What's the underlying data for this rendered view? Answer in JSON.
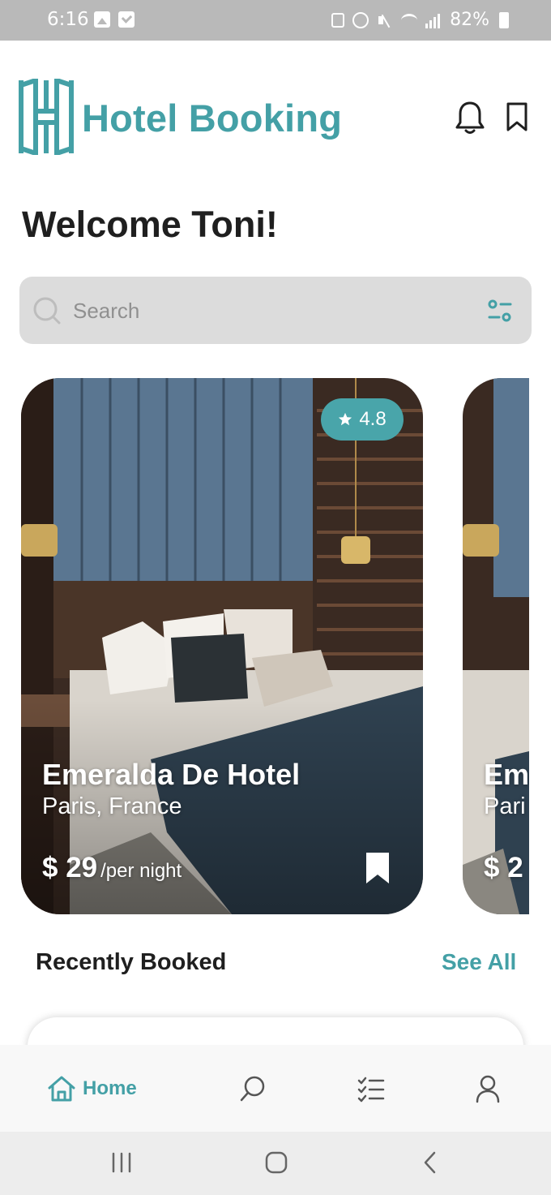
{
  "status_bar": {
    "time": "6:16",
    "battery": "82%"
  },
  "header": {
    "brand": "Hotel Booking",
    "brand_color": "#44a0a6"
  },
  "welcome": "Welcome Toni!",
  "search": {
    "placeholder": "Search"
  },
  "featured": [
    {
      "rating": "4.8",
      "name": "Emeralda De Hotel",
      "location": "Paris, France",
      "price": "$ 29",
      "price_unit": "/per night"
    },
    {
      "name": "Em",
      "location": "Pari",
      "price": "$ 2"
    }
  ],
  "recent": {
    "title": "Recently Booked",
    "see_all": "See All"
  },
  "bottom_nav": {
    "home_label": "Home",
    "active": "home"
  },
  "icons": [
    "hotel-logo-icon",
    "bell-icon",
    "bookmark-icon",
    "search-icon",
    "filter-icon",
    "star-icon",
    "home-icon",
    "bookings-list-icon",
    "profile-icon"
  ]
}
